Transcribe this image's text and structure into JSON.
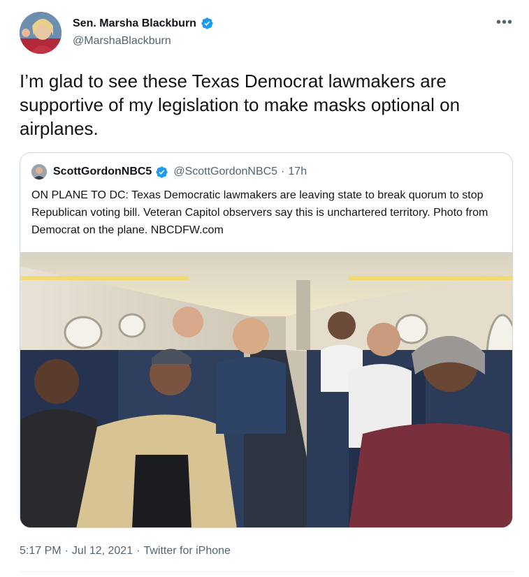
{
  "author": {
    "display_name": "Sen. Marsha Blackburn",
    "handle": "@MarshaBlackburn",
    "verified": true
  },
  "tweet": {
    "text": "I’m glad to see these Texas Democrat lawmakers are supportive of my legislation to make masks optional on airplanes."
  },
  "quoted_tweet": {
    "display_name": "ScottGordonNBC5",
    "handle": "@ScottGordonNBC5",
    "separator": "·",
    "time": "17h",
    "verified": true,
    "text": "ON PLANE TO DC: Texas Democratic lawmakers are leaving state to break quorum to stop Republican voting bill. Veteran Capitol observers say this is unchartered territory. Photo from Democrat on the plane.  NBCDFW.com"
  },
  "footer": {
    "time": "5:17 PM",
    "separator1": "·",
    "date": "Jul 12, 2021",
    "separator2": "·",
    "source": "Twitter for iPhone"
  },
  "icons": {
    "more": "more-options-icon",
    "verified": "verified-badge-icon"
  },
  "colors": {
    "verified_blue": "#1d9bf0",
    "secondary_text": "#536471",
    "border": "#cfd9de"
  }
}
